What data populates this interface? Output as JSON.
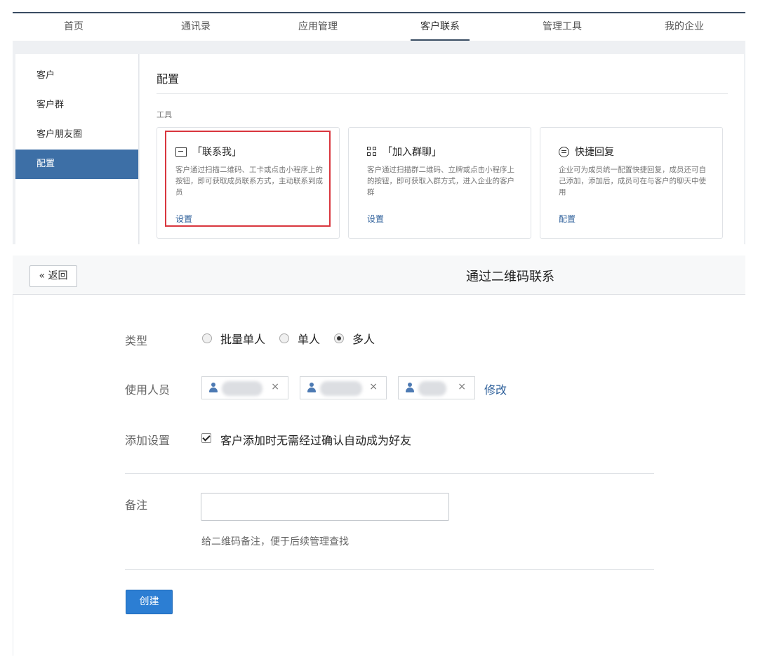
{
  "nav": {
    "tabs": [
      {
        "label": "首页"
      },
      {
        "label": "通讯录"
      },
      {
        "label": "应用管理"
      },
      {
        "label": "客户联系"
      },
      {
        "label": "管理工具"
      },
      {
        "label": "我的企业"
      }
    ],
    "active_index": 3
  },
  "sidebar": {
    "items": [
      {
        "label": "客户"
      },
      {
        "label": "客户群"
      },
      {
        "label": "客户朋友圈"
      },
      {
        "label": "配置"
      }
    ],
    "active_index": 3
  },
  "config": {
    "title": "配置",
    "tools_label": "工具",
    "cards": [
      {
        "title": "「联系我」",
        "desc": "客户通过扫描二维码、工卡或点击小程序上的按钮，即可获取成员联系方式，主动联系到成员",
        "link": "设置",
        "icon": "chat-icon"
      },
      {
        "title": "「加入群聊」",
        "desc": "客户通过扫描群二维码、立牌或点击小程序上的按钮，即可获取入群方式，进入企业的客户群",
        "link": "设置",
        "icon": "qr-icon"
      },
      {
        "title": "快捷回复",
        "desc": "企业可为成员统一配置快捷回复，成员还可自己添加，添加后，成员可在与客户的聊天中使用",
        "link": "配置",
        "icon": "reply-icon"
      }
    ]
  },
  "form": {
    "back_label": "« 返回",
    "page_title": "通过二维码联系",
    "type_label": "类型",
    "type_options": [
      {
        "label": "批量单人",
        "checked": false
      },
      {
        "label": "单人",
        "checked": false
      },
      {
        "label": "多人",
        "checked": true
      }
    ],
    "users_label": "使用人员",
    "remove_glyph": "×",
    "modify_label": "修改",
    "add_setting_label": "添加设置",
    "auto_accept_label": "客户添加时无需经过确认自动成为好友",
    "auto_accept_checked": true,
    "remark_label": "备注",
    "remark_value": "",
    "remark_hint": "给二维码备注，便于后续管理查找",
    "create_label": "创建"
  },
  "colors": {
    "accent": "#3d6fa6",
    "link": "#2d5f9a",
    "primary_button": "#2c7ed3",
    "highlight_border": "#d9363e"
  }
}
